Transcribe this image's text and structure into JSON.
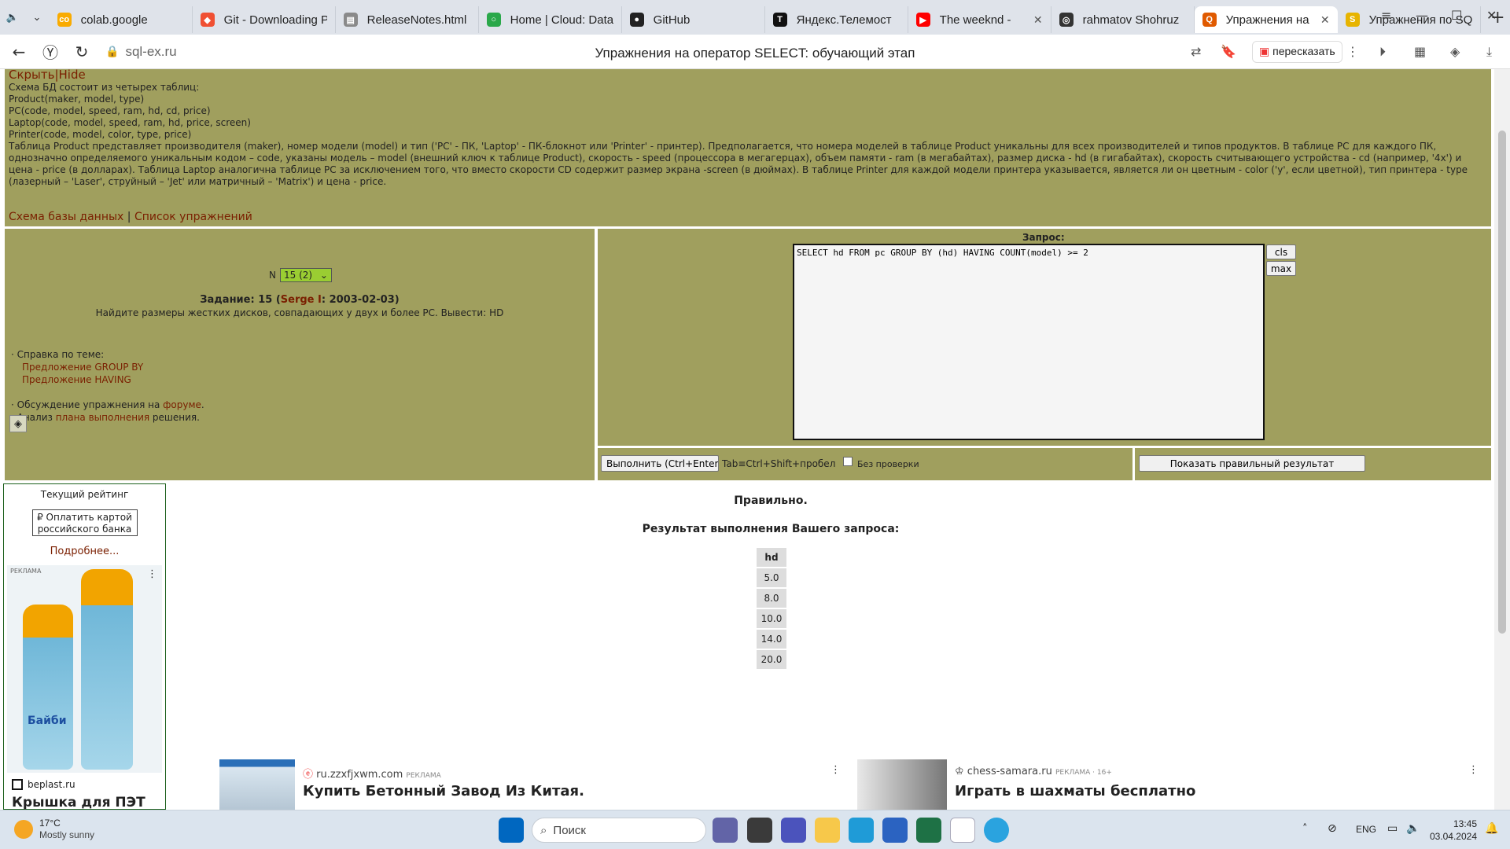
{
  "tabs": [
    {
      "title": "colab.google",
      "color": "#f9ab00",
      "glyph": "co"
    },
    {
      "title": "Git - Downloading P",
      "color": "#f05033",
      "glyph": "◆"
    },
    {
      "title": "ReleaseNotes.html",
      "color": "#8a8a8a",
      "glyph": "▤"
    },
    {
      "title": "Home | Cloud: Data",
      "color": "#2aa84a",
      "glyph": "○"
    },
    {
      "title": "GitHub",
      "color": "#222222",
      "glyph": "●"
    },
    {
      "title": "Яндекс.Телемост",
      "color": "#111111",
      "glyph": "T"
    },
    {
      "title": "The weeknd -",
      "color": "#ff0000",
      "glyph": "▶"
    },
    {
      "title": "rahmatov Shohruz",
      "color": "#333333",
      "glyph": "◎"
    },
    {
      "title": "Упражнения на",
      "color": "#e05a00",
      "glyph": "Q"
    },
    {
      "title": "Упражнения по SQ",
      "color": "#e7b400",
      "glyph": "S"
    }
  ],
  "address": {
    "url": "sql-ex.ru",
    "page_title": "Упражнения на оператор SELECT: обучающий этап",
    "retell": "пересказать"
  },
  "info": {
    "hide": "Скрыть|Hide",
    "lines": [
      "Схема БД состоит из четырех таблиц:",
      "Product(maker, model, type)",
      "PC(code, model, speed, ram, hd, cd, price)",
      "Laptop(code, model, speed, ram, hd, price, screen)",
      "Printer(code, model, color, type, price)"
    ],
    "description": "Таблица Product представляет производителя (maker), номер модели (model) и тип ('PC' - ПК, 'Laptop' - ПК-блокнот или 'Printer' - принтер). Предполагается, что номера моделей в таблице Product уникальны для всех производителей и типов продуктов. В таблице PC для каждого ПК, однозначно определяемого уникальным кодом – code, указаны модель – model (внешний ключ к таблице Product), скорость - speed (процессора в мегагерцах), объем памяти - ram (в мегабайтах), размер диска - hd (в гигабайтах), скорость считывающего устройства - cd (например, '4x') и цена - price (в долларах). Таблица Laptop аналогична таблице PC за исключением того, что вместо скорости CD содержит размер экрана -screen (в дюймах). В таблице Printer для каждой модели принтера указывается, является ли он цветным - color ('y', если цветной), тип принтера - type (лазерный – 'Laser', струйный – 'Jet' или матричный – 'Matrix') и цена - price.",
    "schema_link": "Схема базы данных",
    "separator": "|",
    "exercises_link": "Список упражнений"
  },
  "task": {
    "n_label": "N",
    "selected": "15 (2)",
    "title_prefix": "Задание: 15 (",
    "author": "Serge I",
    "title_suffix": ": 2003-02-03)",
    "text": "Найдите размеры жестких дисков, совпадающих у двух и более PC. Вывести: HD",
    "help_label": "· Справка по теме:",
    "help_links": [
      "Предложение GROUP BY",
      "Предложение HAVING"
    ],
    "forum_prefix": "· Обсуждение упражнения на ",
    "forum_link": "форуме",
    "forum_suffix": ".",
    "plan_prefix": "· Анализ ",
    "plan_link": "плана выполнения",
    "plan_suffix": " решения."
  },
  "query": {
    "label": "Запрос:",
    "text": "SELECT hd FROM pc GROUP BY (hd) HAVING COUNT(model) >= 2",
    "cls": "cls",
    "max": "max",
    "run": "Выполнить (Ctrl+Enter)",
    "tab_hint": "Tab≡Ctrl+Shift+пробел",
    "no_check": "Без проверки",
    "show_result": "Показать правильный результат"
  },
  "result": {
    "status": "Правильно.",
    "heading": "Результат выполнения Вашего запроса:",
    "column": "hd",
    "rows": [
      "5.0",
      "8.0",
      "10.0",
      "14.0",
      "20.0"
    ]
  },
  "sidebar_ad": {
    "rating": "Текущий рейтинг",
    "pay_line1": "₽ Оплатить картой",
    "pay_line2": "российского банка",
    "more": "Подробнее...",
    "ad_label": "РЕКЛАМА",
    "bottle_brand": "Байби",
    "site": "beplast.ru",
    "headline": "Крышка для ПЭТ"
  },
  "ads": [
    {
      "domain": "ru.zzxfjxwm.com",
      "label": "РЕКЛАМА",
      "headline": "Купить Бетонный Завод Из Китая."
    },
    {
      "domain": "chess-samara.ru",
      "label": "РЕКЛАМА · 16+",
      "headline": "Играть в шахматы бесплатно"
    }
  ],
  "taskbar": {
    "temp": "17°C",
    "weather": "Mostly sunny",
    "search": "Поиск",
    "lang": "ENG",
    "time": "13:45",
    "date": "03.04.2024"
  }
}
